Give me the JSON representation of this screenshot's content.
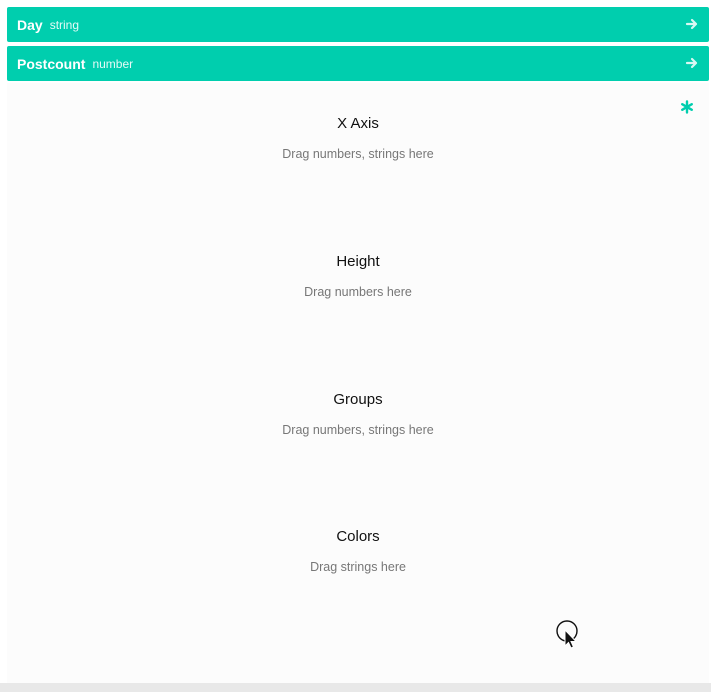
{
  "fields": [
    {
      "name": "Day",
      "type": "string"
    },
    {
      "name": "Postcount",
      "type": "number"
    }
  ],
  "zones": [
    {
      "title": "X Axis",
      "hint": "Drag numbers, strings here"
    },
    {
      "title": "Height",
      "hint": "Drag numbers here"
    },
    {
      "title": "Groups",
      "hint": "Drag numbers, strings here"
    },
    {
      "title": "Colors",
      "hint": "Drag strings here"
    }
  ],
  "icons": {
    "field_arrow": "arrow-right-icon",
    "required_marker": "asterisk-icon",
    "cursor": "mouse-pointer-icon"
  },
  "colors": {
    "accent": "#00ceae",
    "panel_bg": "#fcfcfc",
    "hint_text": "#777777"
  }
}
